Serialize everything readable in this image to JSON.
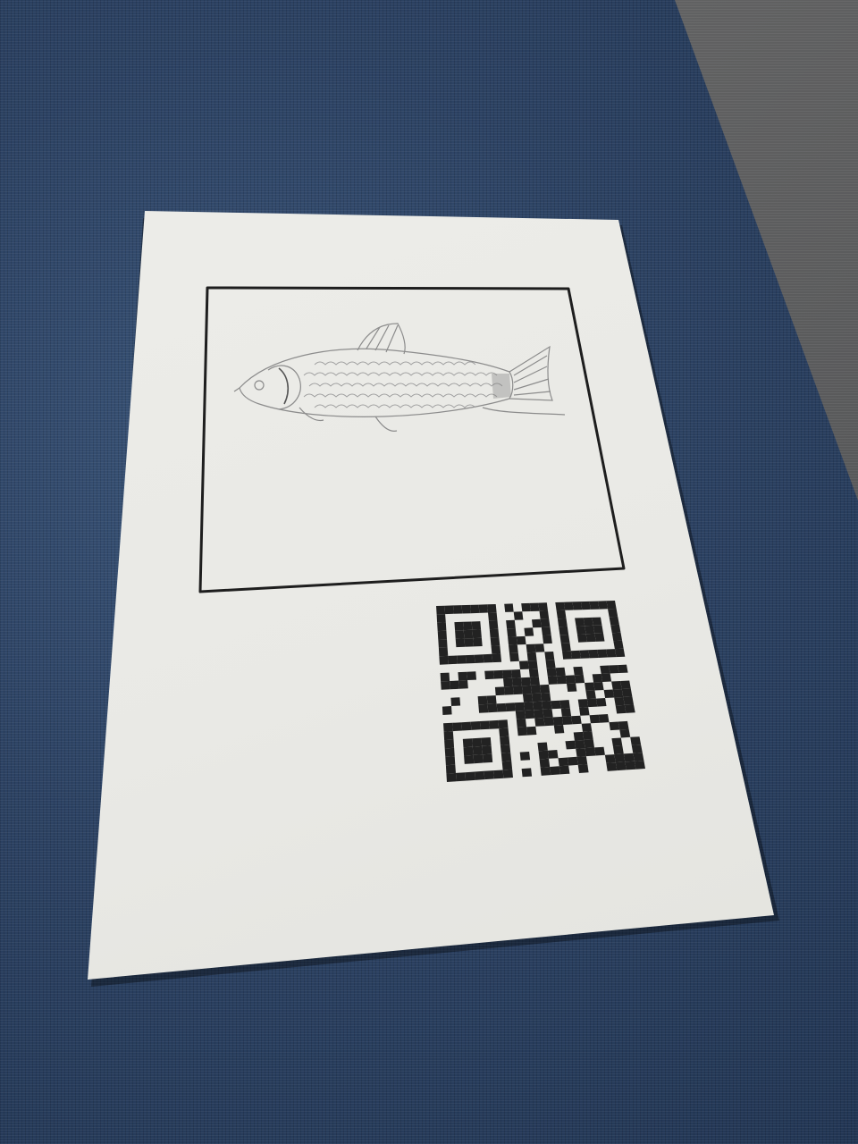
{
  "scene": {
    "subject": "printed-sheet-on-carpet",
    "colors": {
      "carpet_blue": "#2f4668",
      "carpet_gray": "#5d5e60",
      "paper": "#ebebe7",
      "ink": "#1e1e1e",
      "sketch": "#8a8a8a"
    }
  },
  "sheet": {
    "illustration": "fish-sketch",
    "code": "qr-code"
  }
}
